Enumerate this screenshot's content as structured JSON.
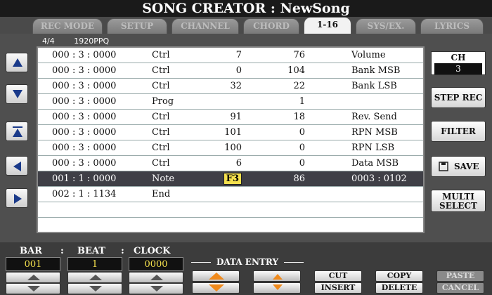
{
  "window": {
    "title": "SONG CREATOR : NewSong"
  },
  "tabs": [
    {
      "label": "REC MODE",
      "active": false
    },
    {
      "label": "SETUP",
      "active": false
    },
    {
      "label": "CHANNEL",
      "active": false
    },
    {
      "label": "CHORD",
      "active": false
    },
    {
      "label": "1-16",
      "active": true
    },
    {
      "label": "SYS/EX.",
      "active": false
    },
    {
      "label": "LYRICS",
      "active": false
    }
  ],
  "info": {
    "time_signature": "4/4",
    "resolution": "1920PPQ"
  },
  "events": [
    {
      "time": "000 : 3 : 0000",
      "type": "Ctrl",
      "d1": "7",
      "d2": "76",
      "name": "Volume"
    },
    {
      "time": "000 : 3 : 0000",
      "type": "Ctrl",
      "d1": "0",
      "d2": "104",
      "name": "Bank MSB"
    },
    {
      "time": "000 : 3 : 0000",
      "type": "Ctrl",
      "d1": "32",
      "d2": "22",
      "name": "Bank LSB"
    },
    {
      "time": "000 : 3 : 0000",
      "type": "Prog",
      "d1": "",
      "d2": "1",
      "name": ""
    },
    {
      "time": "000 : 3 : 0000",
      "type": "Ctrl",
      "d1": "91",
      "d2": "18",
      "name": "Rev. Send"
    },
    {
      "time": "000 : 3 : 0000",
      "type": "Ctrl",
      "d1": "101",
      "d2": "0",
      "name": "RPN MSB"
    },
    {
      "time": "000 : 3 : 0000",
      "type": "Ctrl",
      "d1": "100",
      "d2": "0",
      "name": "RPN LSB"
    },
    {
      "time": "000 : 3 : 0000",
      "type": "Ctrl",
      "d1": "6",
      "d2": "0",
      "name": "Data MSB"
    },
    {
      "time": "001 : 1 : 0000",
      "type": "Note",
      "d1": "F3",
      "d2": "86",
      "name": "0003   : 0102"
    },
    {
      "time": "002 : 1 : 1134",
      "type": "End",
      "d1": "",
      "d2": "",
      "name": ""
    }
  ],
  "channel": {
    "label": "CH",
    "value": "3"
  },
  "side_buttons": {
    "step_rec": "STEP REC",
    "filter": "FILTER",
    "save": "SAVE",
    "multi_select_1": "MULTI",
    "multi_select_2": "SELECT"
  },
  "position": {
    "bar_label": "BAR",
    "beat_label": "BEAT",
    "clock_label": "CLOCK",
    "bar": "001",
    "beat": "1",
    "clock": "0000",
    "separator": ":"
  },
  "data_entry": {
    "label": "DATA ENTRY"
  },
  "edit_buttons": {
    "cut": "CUT",
    "insert": "INSERT",
    "copy": "COPY",
    "delete": "DELETE",
    "paste": "PASTE",
    "cancel": "CANCEL"
  },
  "colors": {
    "selected_row": "#3f3f46",
    "highlight": "#f4e04d",
    "orange_arrow": "#f08a1c"
  }
}
